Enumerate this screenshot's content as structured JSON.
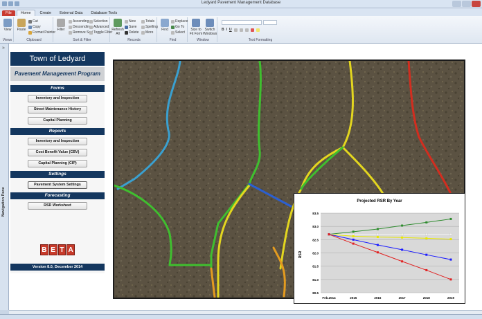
{
  "window": {
    "title": "Ledyard Pavement Management Database"
  },
  "tabs": [
    "File",
    "Home",
    "Create",
    "External Data",
    "Database Tools"
  ],
  "ribbon": {
    "views": {
      "view": "View",
      "label": "Views"
    },
    "clipboard": {
      "paste": "Paste",
      "cut": "Cut",
      "copy": "Copy",
      "format_painter": "Format Painter",
      "label": "Clipboard"
    },
    "sort_filter": {
      "filter": "Filter",
      "ascending": "Ascending",
      "descending": "Descending",
      "remove_sort": "Remove Sort",
      "selection": "Selection",
      "advanced": "Advanced",
      "toggle_filter": "Toggle Filter",
      "label": "Sort & Filter"
    },
    "records": {
      "refresh": "Refresh All",
      "new": "New",
      "save": "Save",
      "delete": "Delete",
      "totals": "Totals",
      "spelling": "Spelling",
      "more": "More",
      "label": "Records"
    },
    "find": {
      "find": "Find",
      "replace": "Replace",
      "goto": "Go To",
      "select": "Select",
      "label": "Find"
    },
    "window": {
      "size_to_fit": "Size to Fit Form",
      "switch_windows": "Switch Windows",
      "label": "Window"
    },
    "text_formatting": {
      "label": "Text Formatting"
    }
  },
  "nav_pane": {
    "label": "Navigation Pane"
  },
  "menu": {
    "town": "Town of Ledyard",
    "program": "Pavement Management Program",
    "forms_header": "Forms",
    "forms": [
      "Inventory and Inspection",
      "Street Maintenance History",
      "Capital Planning"
    ],
    "reports_header": "Reports",
    "reports": [
      "Inventory and Inspection",
      "Cost Benefit Value (CBV)",
      "Capital Planning (CIP)"
    ],
    "settings_header": "Settings",
    "settings": [
      "Pavement System Settings"
    ],
    "forecasting_header": "Forecasting",
    "forecasting": [
      "RSR Worksheet"
    ],
    "beta": [
      "B",
      "E",
      "T",
      "A"
    ],
    "version": "Version 8.0, December 2014"
  },
  "colors": {
    "accent": "#14375f",
    "file_tab": "#c93a2f",
    "beta": "#c73a2a"
  },
  "chart_data": {
    "type": "line",
    "title": "Projected RSR By Year",
    "xlabel": "",
    "ylabel": "RSR",
    "categories": [
      "Feb.2014",
      "2015",
      "2016",
      "2017",
      "2018",
      "2019"
    ],
    "ylim": [
      80.5,
      83.5
    ],
    "yticks": [
      "80.5",
      "81.0",
      "81.5",
      "82.0",
      "82.5",
      "83.0",
      "83.5"
    ],
    "grid": true,
    "series": [
      {
        "color": "#2e8b2e",
        "values": [
          82.7,
          82.8,
          82.9,
          83.03,
          83.15,
          83.28
        ]
      },
      {
        "color": "#f0f0f0",
        "values": [
          82.7,
          82.7,
          82.7,
          82.7,
          82.7,
          82.7
        ]
      },
      {
        "color": "#e8e800",
        "values": [
          82.7,
          82.63,
          82.6,
          82.58,
          82.55,
          82.52
        ]
      },
      {
        "color": "#1a1aff",
        "values": [
          82.7,
          82.5,
          82.3,
          82.12,
          81.93,
          81.75
        ]
      },
      {
        "color": "#e02020",
        "values": [
          82.7,
          82.35,
          82.02,
          81.68,
          81.35,
          81.0
        ]
      }
    ]
  }
}
